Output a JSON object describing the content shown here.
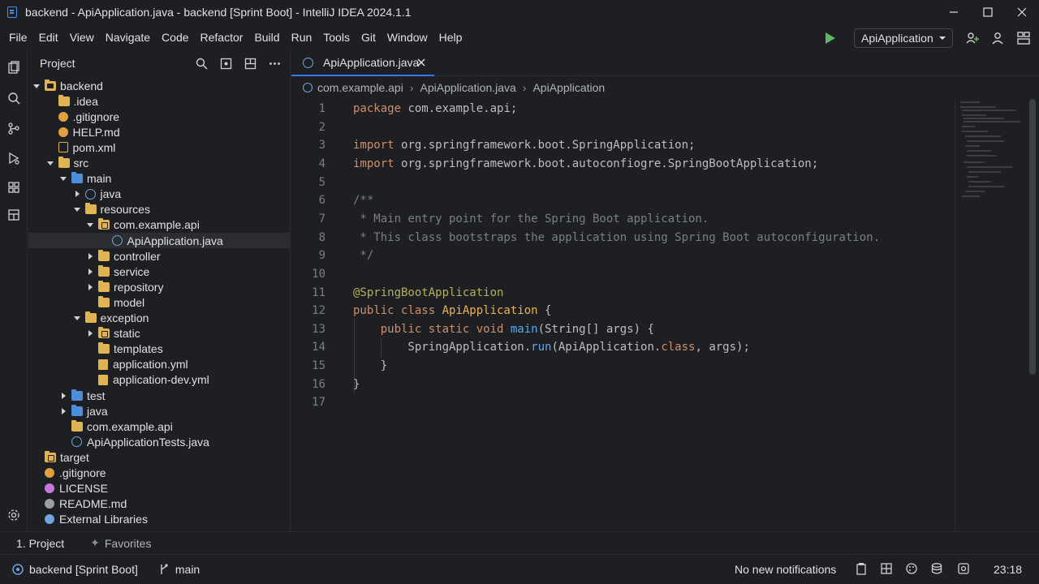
{
  "window": {
    "title": "backend - ApiApplication.java - backend [Sprint Boot] - IntelliJ IDEA 2024.1.1"
  },
  "menu": [
    "File",
    "Edit",
    "View",
    "Navigate",
    "Code",
    "Refactor",
    "Build",
    "Run",
    "Tools",
    "Git",
    "Window",
    "Help"
  ],
  "toolbar": {
    "run_config": "ApiApplication"
  },
  "project_panel": {
    "title": "Project",
    "tree": [
      {
        "label": "backend",
        "depth": 0,
        "icon": "module-folder-icon",
        "arrow": "down"
      },
      {
        "label": ".idea",
        "depth": 1,
        "icon": "folder-icon",
        "arrow": ""
      },
      {
        "label": ".gitignore",
        "depth": 1,
        "icon": "gitignore-file-icon",
        "arrow": ""
      },
      {
        "label": "HELP.md",
        "depth": 1,
        "icon": "markdown-file-icon",
        "arrow": ""
      },
      {
        "label": "pom.xml",
        "depth": 1,
        "icon": "xml-file-icon",
        "arrow": ""
      },
      {
        "label": "src",
        "depth": 1,
        "icon": "folder-icon",
        "arrow": "down"
      },
      {
        "label": "main",
        "depth": 2,
        "icon": "blue-folder-icon",
        "arrow": "down"
      },
      {
        "label": "java",
        "depth": 3,
        "icon": "module-icon",
        "arrow": "right"
      },
      {
        "label": "resources",
        "depth": 3,
        "icon": "folder-icon",
        "arrow": "down"
      },
      {
        "label": "com.example.api",
        "depth": 4,
        "icon": "package-icon",
        "arrow": "down"
      },
      {
        "label": "ApiApplication.java",
        "depth": 5,
        "icon": "java-class-icon",
        "arrow": ""
      },
      {
        "label": "controller",
        "depth": 4,
        "icon": "folder-icon",
        "arrow": "right"
      },
      {
        "label": "service",
        "depth": 4,
        "icon": "folder-icon",
        "arrow": "right"
      },
      {
        "label": "repository",
        "depth": 4,
        "icon": "folder-icon",
        "arrow": "right"
      },
      {
        "label": "model",
        "depth": 4,
        "icon": "folder-icon",
        "arrow": ""
      },
      {
        "label": "exception",
        "depth": 3,
        "icon": "folder-icon",
        "arrow": "down"
      },
      {
        "label": "static",
        "depth": 4,
        "icon": "package-icon",
        "arrow": "right"
      },
      {
        "label": "templates",
        "depth": 4,
        "icon": "folder-icon",
        "arrow": ""
      },
      {
        "label": "application.yml",
        "depth": 4,
        "icon": "yaml-file-icon",
        "arrow": ""
      },
      {
        "label": "application-dev.yml",
        "depth": 4,
        "icon": "yaml-file-icon",
        "arrow": ""
      },
      {
        "label": "test",
        "depth": 2,
        "icon": "blue-folder-icon",
        "arrow": "right"
      },
      {
        "label": "java",
        "depth": 2,
        "icon": "blue-folder-icon",
        "arrow": "right"
      },
      {
        "label": "com.example.api",
        "depth": 2,
        "icon": "folder-icon",
        "arrow": ""
      },
      {
        "label": "ApiApplicationTests.java",
        "depth": 2,
        "icon": "java-class-icon",
        "arrow": ""
      },
      {
        "label": "target",
        "depth": 0,
        "icon": "package-icon",
        "arrow": ""
      },
      {
        "label": ".gitignore",
        "depth": 0,
        "icon": "gitignore-file-icon",
        "arrow": ""
      },
      {
        "label": "LICENSE",
        "depth": 0,
        "icon": "license-file-icon",
        "arrow": ""
      },
      {
        "label": "README.md",
        "depth": 0,
        "icon": "readme-file-icon",
        "arrow": ""
      },
      {
        "label": "External Libraries",
        "depth": 0,
        "icon": "libraries-icon",
        "arrow": ""
      }
    ],
    "selected_index": 10
  },
  "editor": {
    "tab_label": "ApiApplication.java",
    "breadcrumb": [
      "com.example.api",
      "ApiApplication.java",
      "ApiApplication"
    ],
    "line_numbers": [
      "1",
      "2",
      "3",
      "4",
      "5",
      "6",
      "7",
      "8",
      "9",
      "10",
      "11",
      "12",
      "13",
      "14",
      "15",
      "16",
      "17"
    ],
    "lines": [
      [
        {
          "t": "package ",
          "c": "kw"
        },
        {
          "t": "com.example.api;",
          "c": "pk"
        }
      ],
      [],
      [
        {
          "t": "import ",
          "c": "kw"
        },
        {
          "t": "org.springframework.boot.SpringApplication;",
          "c": "pk"
        }
      ],
      [
        {
          "t": "import ",
          "c": "kw"
        },
        {
          "t": "org.springframework.boot.autoconfiogre.SpringBootApplication;",
          "c": "pk"
        }
      ],
      [],
      [
        {
          "t": "/**",
          "c": "cm"
        }
      ],
      [
        {
          "t": " * Main entry point for the Spring Boot application.",
          "c": "cm"
        }
      ],
      [
        {
          "t": " * This class bootstraps the application using Spring Boot autoconfiguration.",
          "c": "cm"
        }
      ],
      [
        {
          "t": " */",
          "c": "cm"
        }
      ],
      [],
      [
        {
          "t": "@SpringBootApplication",
          "c": "an"
        }
      ],
      [
        {
          "t": "public class ",
          "c": "kw"
        },
        {
          "t": "ApiApplication",
          "c": "cls"
        },
        {
          "t": " {",
          "c": "pk"
        }
      ],
      [
        {
          "t": "    public static void ",
          "c": "kw"
        },
        {
          "t": "main",
          "c": "fn"
        },
        {
          "t": "(String[] args) {",
          "c": "pk"
        }
      ],
      [
        {
          "t": "        SpringApplication.",
          "c": "pk"
        },
        {
          "t": "run",
          "c": "fn"
        },
        {
          "t": "(ApiApplication.",
          "c": "pk"
        },
        {
          "t": "class",
          "c": "kw"
        },
        {
          "t": ", args);",
          "c": "pk"
        }
      ],
      [
        {
          "t": "    }",
          "c": "pk"
        }
      ],
      [
        {
          "t": "}",
          "c": "pk"
        }
      ],
      []
    ]
  },
  "bottom_tabs": [
    "1. Project",
    "Favorites"
  ],
  "status": {
    "project": "backend [Sprint Boot]",
    "branch": "main",
    "notifications": "No new notifications",
    "time": "23:18"
  },
  "colors": {
    "accent": "#3574f0",
    "selection": "#2e436e",
    "run_green": "#5fb865"
  }
}
